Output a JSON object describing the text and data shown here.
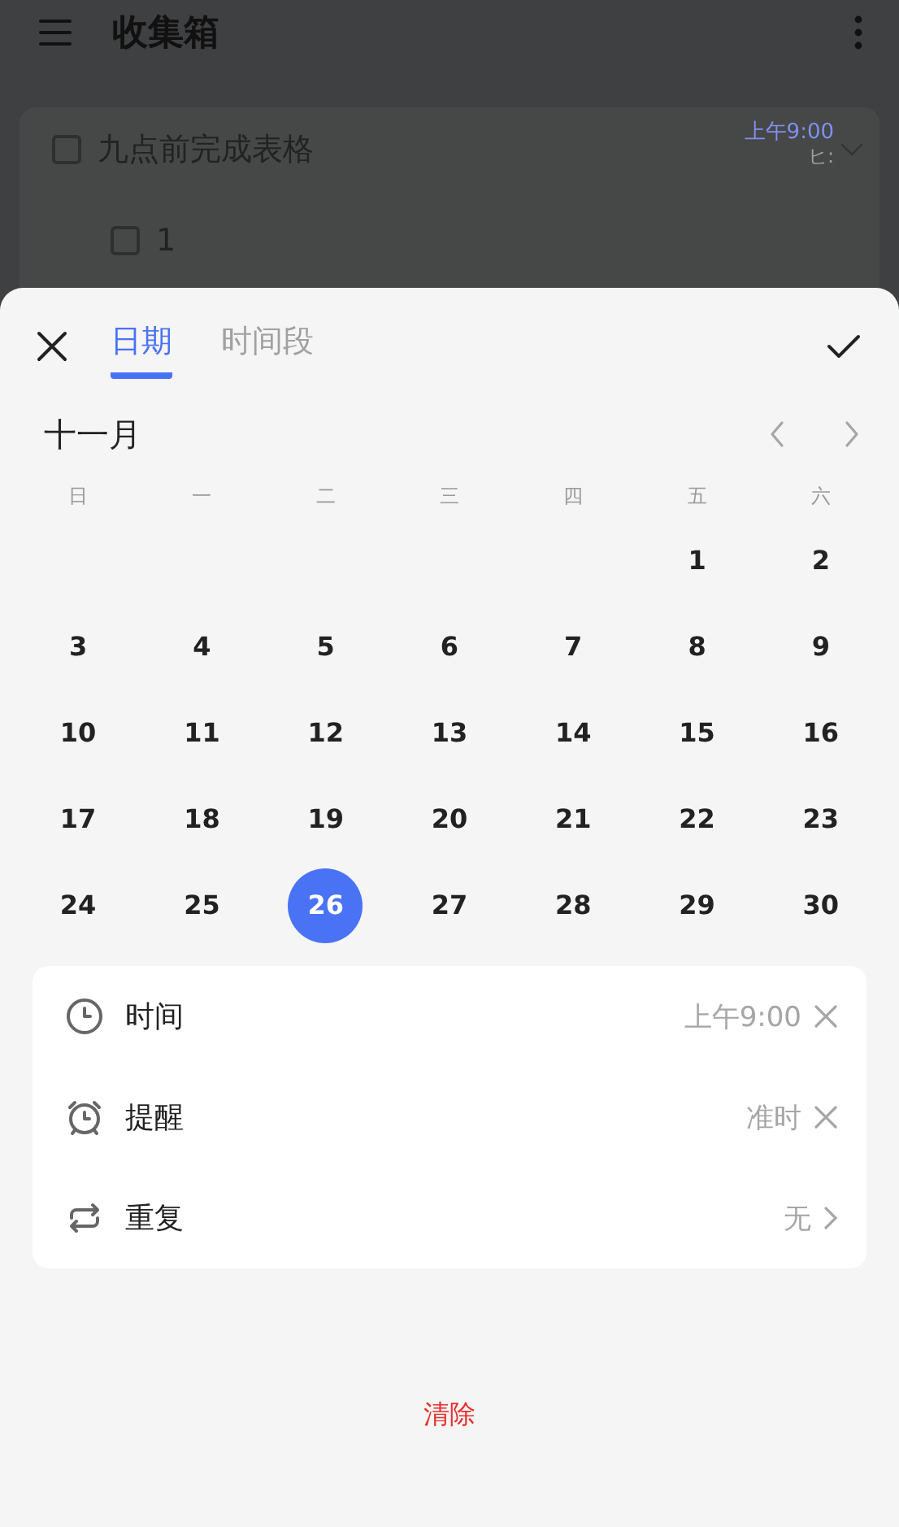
{
  "app_bar": {
    "title": "收集箱"
  },
  "task_card": {
    "tasks": [
      {
        "title": "九点前完成表格",
        "checked": false,
        "due": "上午9:00",
        "due_fragment": "ヒ:",
        "children": [
          {
            "title": "1",
            "checked": false
          }
        ]
      }
    ]
  },
  "sheet": {
    "tabs": [
      {
        "label": "日期",
        "selected": true
      },
      {
        "label": "时间段",
        "selected": false
      }
    ],
    "month": "十一月",
    "weekdays": [
      "日",
      "一",
      "二",
      "三",
      "四",
      "五",
      "六"
    ],
    "weeks": [
      [
        {
          "label": "1",
          "selected": false
        },
        {
          "label": "2",
          "selected": false
        }
      ],
      [
        {
          "label": "3",
          "selected": false
        },
        {
          "label": "4",
          "selected": false
        },
        {
          "label": "5",
          "selected": false
        },
        {
          "label": "6",
          "selected": false
        },
        {
          "label": "7",
          "selected": false
        },
        {
          "label": "8",
          "selected": false
        },
        {
          "label": "9",
          "selected": false
        }
      ],
      [
        {
          "label": "10",
          "selected": false
        },
        {
          "label": "11",
          "selected": false
        },
        {
          "label": "12",
          "selected": false
        },
        {
          "label": "13",
          "selected": false
        },
        {
          "label": "14",
          "selected": false
        },
        {
          "label": "15",
          "selected": false
        },
        {
          "label": "16",
          "selected": false
        }
      ],
      [
        {
          "label": "17",
          "selected": false
        },
        {
          "label": "18",
          "selected": false
        },
        {
          "label": "19",
          "selected": false
        },
        {
          "label": "20",
          "selected": false
        },
        {
          "label": "21",
          "selected": false
        },
        {
          "label": "22",
          "selected": false
        },
        {
          "label": "23",
          "selected": false
        }
      ],
      [
        {
          "label": "24",
          "selected": false
        },
        {
          "label": "25",
          "selected": false
        },
        {
          "label": "26",
          "selected": true
        },
        {
          "label": "27",
          "selected": false
        },
        {
          "label": "28",
          "selected": false
        },
        {
          "label": "29",
          "selected": false
        },
        {
          "label": "30",
          "selected": false
        }
      ]
    ],
    "options": [
      {
        "kind": "time",
        "label": "时间",
        "value": "上午9:00",
        "clearable": true
      },
      {
        "kind": "reminder",
        "label": "提醒",
        "value": "准时",
        "clearable": true
      },
      {
        "kind": "repeat",
        "label": "重复",
        "value": "无",
        "clearable": false
      }
    ],
    "clear_button": "清除"
  }
}
